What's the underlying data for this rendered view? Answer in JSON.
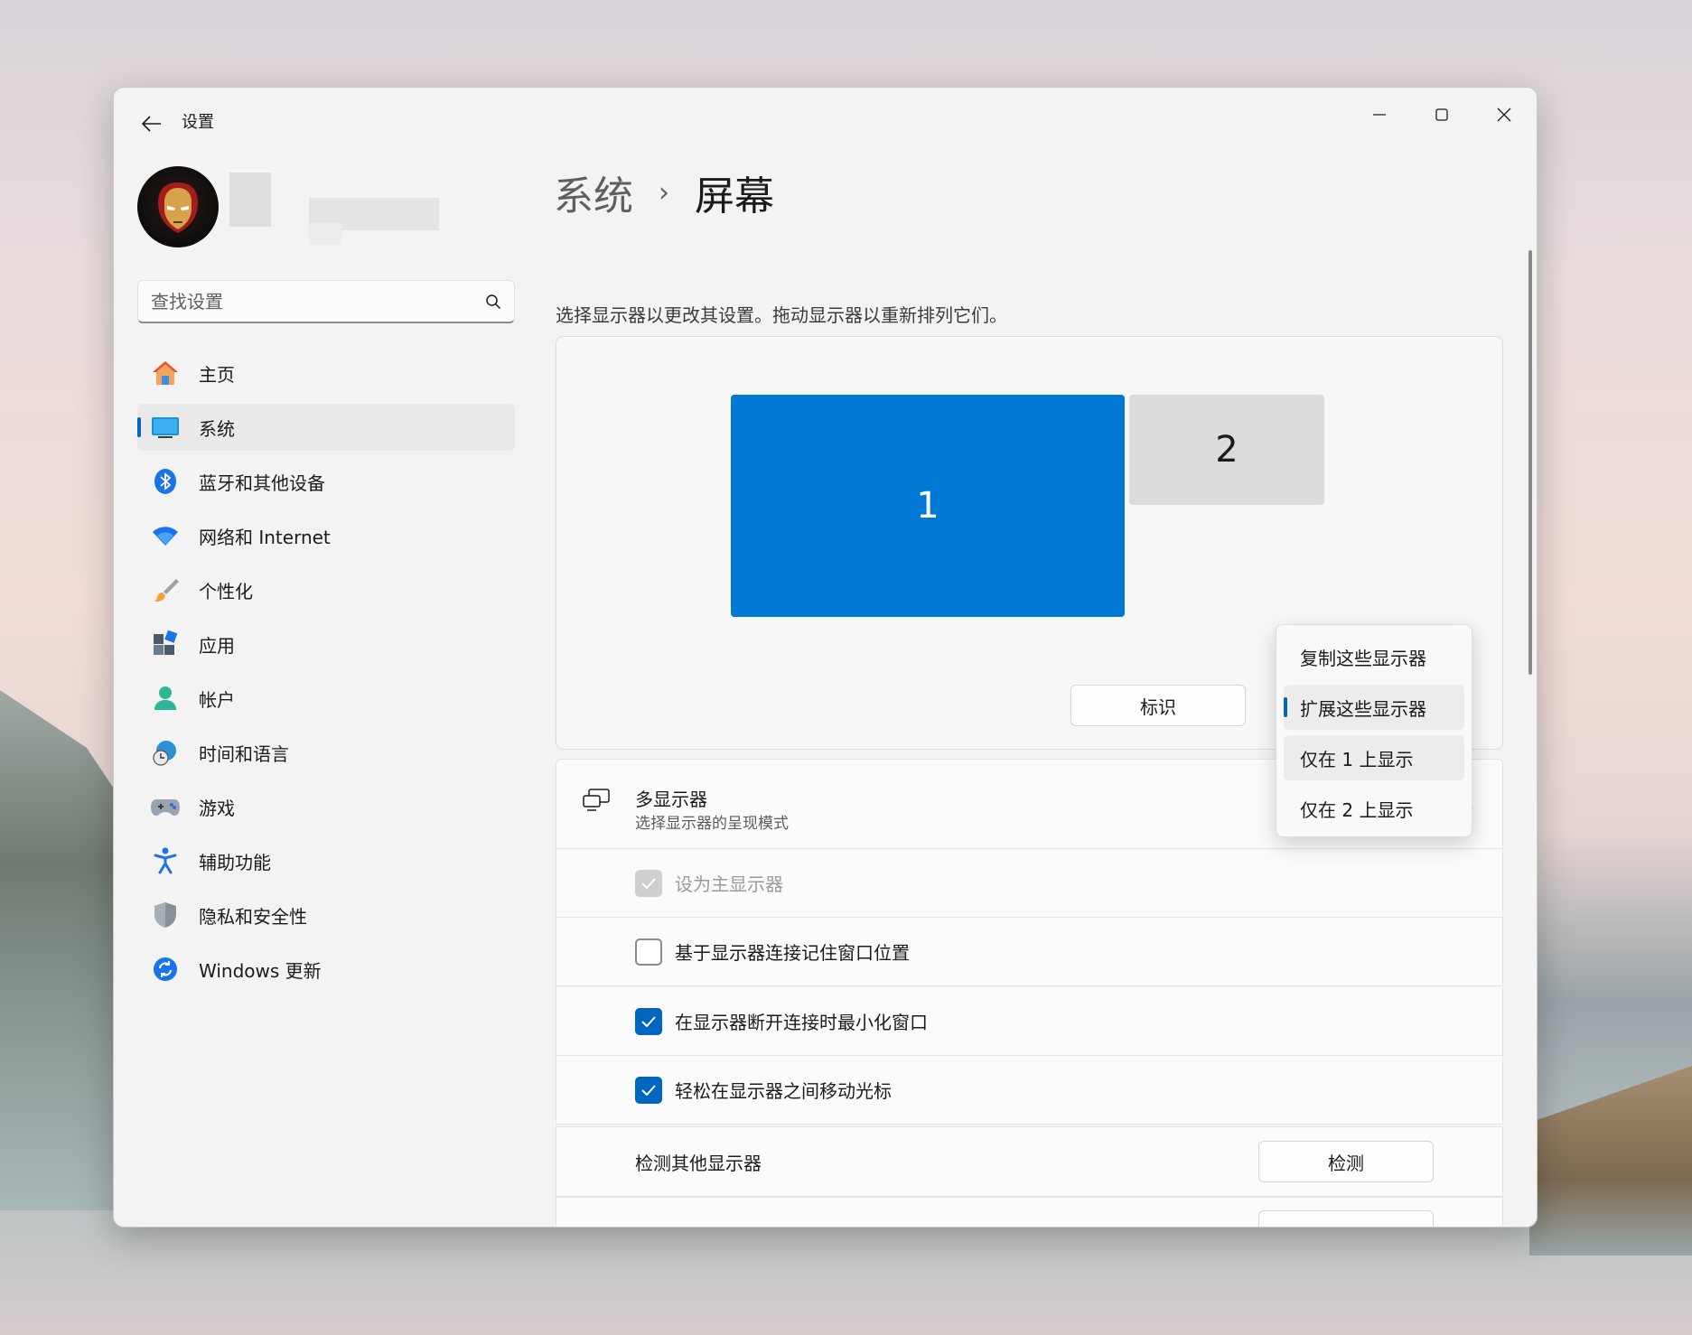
{
  "window": {
    "title": "设置",
    "controls": {
      "minimize": "minimize",
      "maximize": "maximize",
      "close": "close"
    }
  },
  "search": {
    "placeholder": "查找设置"
  },
  "sidebar": {
    "items": [
      {
        "label": "主页",
        "icon": "home-icon",
        "active": false
      },
      {
        "label": "系统",
        "icon": "display-icon",
        "active": true
      },
      {
        "label": "蓝牙和其他设备",
        "icon": "bluetooth-icon",
        "active": false
      },
      {
        "label": "网络和 Internet",
        "icon": "wifi-icon",
        "active": false
      },
      {
        "label": "个性化",
        "icon": "brush-icon",
        "active": false
      },
      {
        "label": "应用",
        "icon": "apps-icon",
        "active": false
      },
      {
        "label": "帐户",
        "icon": "person-icon",
        "active": false
      },
      {
        "label": "时间和语言",
        "icon": "globe-clock-icon",
        "active": false
      },
      {
        "label": "游戏",
        "icon": "gamepad-icon",
        "active": false
      },
      {
        "label": "辅助功能",
        "icon": "accessibility-icon",
        "active": false
      },
      {
        "label": "隐私和安全性",
        "icon": "shield-icon",
        "active": false
      },
      {
        "label": "Windows 更新",
        "icon": "update-icon",
        "active": false
      }
    ]
  },
  "header": {
    "parent": "系统",
    "separator": "›",
    "current": "屏幕"
  },
  "arrange": {
    "hint": "选择显示器以更改其设置。拖动显示器以重新排列它们。",
    "monitor1": "1",
    "monitor2": "2",
    "identify_label": "标识"
  },
  "multi_display": {
    "title": "多显示器",
    "subtitle": "选择显示器的呈现模式",
    "options": [
      {
        "label": "设为主显示器",
        "checked": true,
        "disabled": true
      },
      {
        "label": "基于显示器连接记住窗口位置",
        "checked": false,
        "disabled": false
      },
      {
        "label": "在显示器断开连接时最小化窗口",
        "checked": true,
        "disabled": false
      },
      {
        "label": "轻松在显示器之间移动光标",
        "checked": true,
        "disabled": false
      }
    ],
    "detect": {
      "label": "检测其他显示器",
      "button": "检测"
    }
  },
  "dropdown": {
    "items": [
      {
        "label": "复制这些显示器",
        "selected": false
      },
      {
        "label": "扩展这些显示器",
        "selected": true
      },
      {
        "label": "仅在 1 上显示",
        "selected": false
      },
      {
        "label": "仅在 2 上显示",
        "selected": false
      }
    ]
  },
  "colors": {
    "accent": "#0067c0",
    "monitor_selected": "#0078d4",
    "monitor_other": "#dcdcdc"
  }
}
